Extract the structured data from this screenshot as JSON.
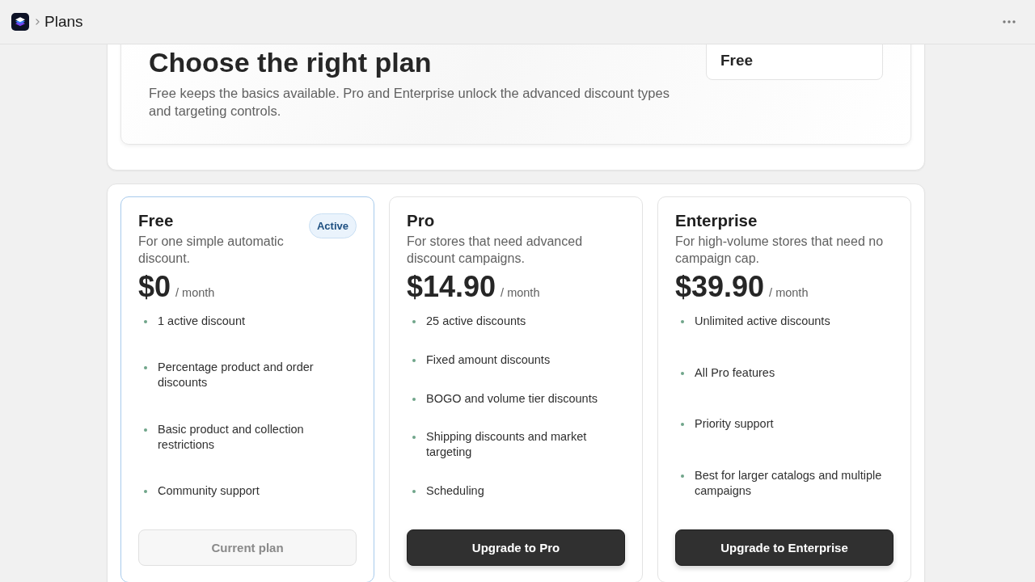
{
  "header": {
    "title": "Plans"
  },
  "hero": {
    "title": "Choose the right plan",
    "subtitle": "Free keeps the basics available. Pro and Enterprise unlock the advanced discount types and targeting controls.",
    "current_plan": {
      "value": "Free"
    }
  },
  "plans": [
    {
      "name": "Free",
      "selected": true,
      "badge": "Active",
      "description": "For one simple automatic discount.",
      "price": "$0",
      "period": "/ month",
      "features": [
        "1 active discount",
        "Percentage product and order discounts",
        "Basic product and collection restrictions",
        "Community support"
      ],
      "button": {
        "label": "Current plan",
        "disabled": true
      }
    },
    {
      "name": "Pro",
      "selected": false,
      "description": "For stores that need advanced discount campaigns.",
      "price": "$14.90",
      "period": "/ month",
      "features": [
        "25 active discounts",
        "Fixed amount discounts",
        "BOGO and volume tier discounts",
        "Shipping discounts and market targeting",
        "Scheduling"
      ],
      "button": {
        "label": "Upgrade to Pro",
        "disabled": false
      }
    },
    {
      "name": "Enterprise",
      "selected": false,
      "description": "For high-volume stores that need no campaign cap.",
      "price": "$39.90",
      "period": "/ month",
      "features": [
        "Unlimited active discounts",
        "All Pro features",
        "Priority support",
        "Best for larger catalogs and multiple campaigns"
      ],
      "button": {
        "label": "Upgrade to Enterprise",
        "disabled": false
      }
    }
  ]
}
